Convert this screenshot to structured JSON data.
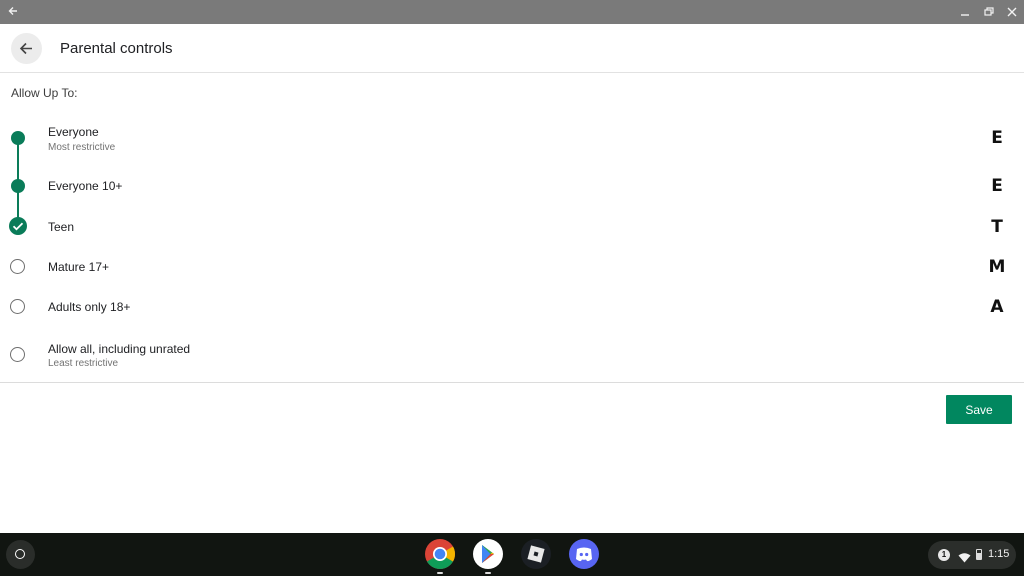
{
  "window": {
    "back_icon": "arrow-left-icon",
    "controls": [
      "minimize-icon",
      "restore-icon",
      "close-icon"
    ]
  },
  "header": {
    "title": "Parental controls",
    "back_icon": "arrow-left-icon"
  },
  "content": {
    "allow_label": "Allow Up To:",
    "options": [
      {
        "label": "Everyone",
        "sublabel": "Most restrictive",
        "state": "included",
        "rating_icon": "esrb-e-icon",
        "rating_text": "E"
      },
      {
        "label": "Everyone 10+",
        "sublabel": "",
        "state": "included",
        "rating_icon": "esrb-e10-icon",
        "rating_text": "E"
      },
      {
        "label": "Teen",
        "sublabel": "",
        "state": "selected",
        "rating_icon": "esrb-t-icon",
        "rating_text": "T"
      },
      {
        "label": "Mature 17+",
        "sublabel": "",
        "state": "unselected",
        "rating_icon": "esrb-m-icon",
        "rating_text": "M"
      },
      {
        "label": "Adults only 18+",
        "sublabel": "",
        "state": "unselected",
        "rating_icon": "esrb-ao-icon",
        "rating_text": "A"
      },
      {
        "label": "Allow all, including unrated",
        "sublabel": "Least restrictive",
        "state": "unselected",
        "rating_icon": "",
        "rating_text": ""
      }
    ],
    "save_label": "Save"
  },
  "shelf": {
    "launcher_icon": "launcher-circle-icon",
    "apps": [
      {
        "name": "chrome-icon",
        "active": true
      },
      {
        "name": "play-store-icon",
        "active": true
      },
      {
        "name": "roblox-icon",
        "active": false
      },
      {
        "name": "discord-icon",
        "active": false
      }
    ],
    "tray": {
      "notification_count": "1",
      "wifi_icon": "wifi-icon",
      "battery_icon": "battery-icon",
      "time": "1:15"
    }
  },
  "colors": {
    "accent": "#01875f",
    "titlebar": "#7a7a7a",
    "shelf": "#111511"
  }
}
